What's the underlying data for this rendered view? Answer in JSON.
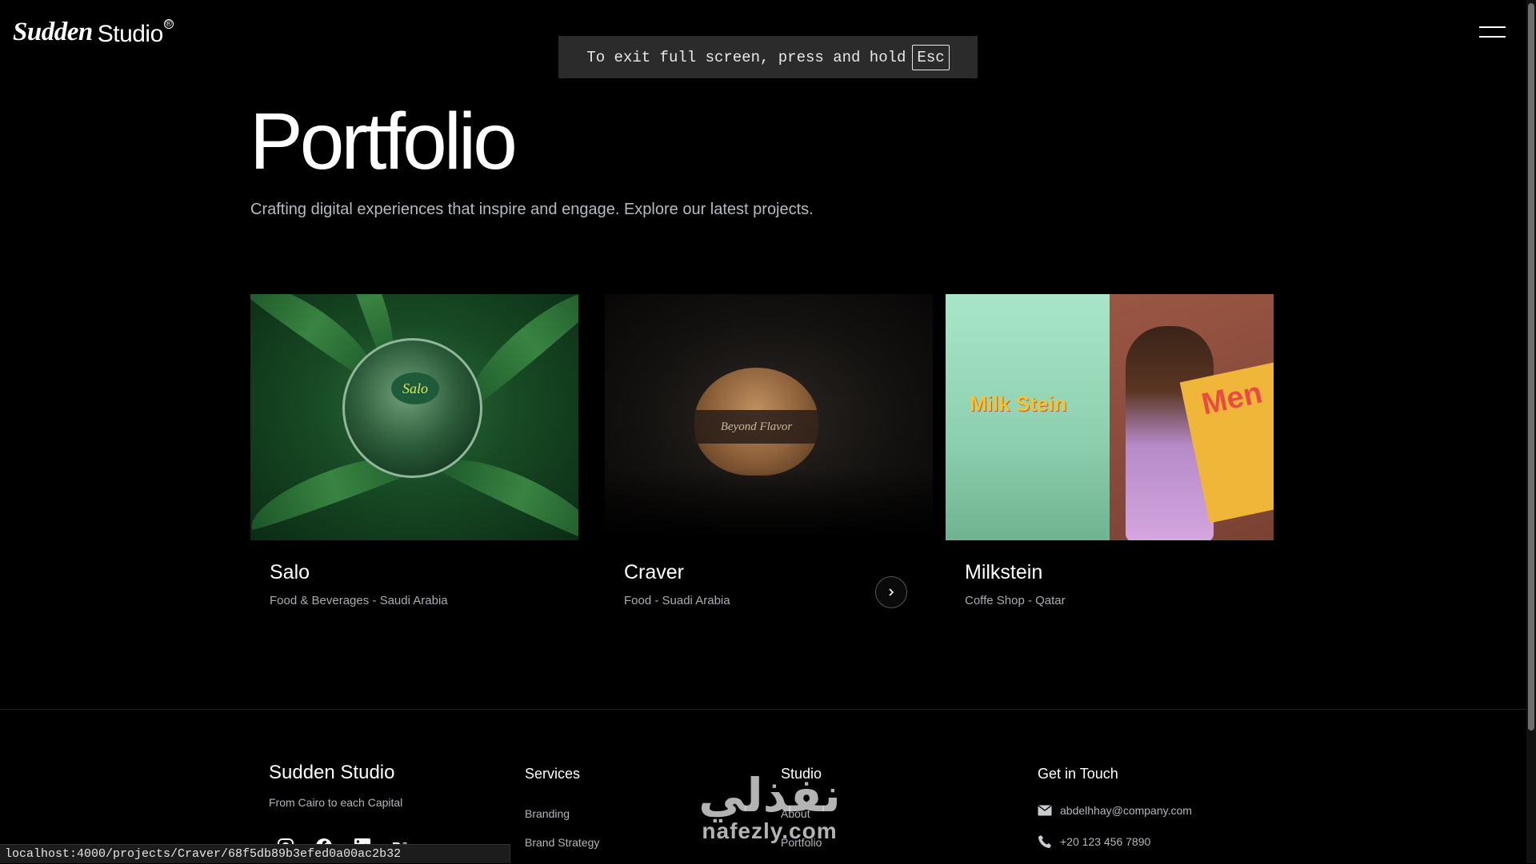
{
  "header": {
    "logo_bold": "Sudden",
    "logo_light": "Studio",
    "logo_reg": "®",
    "menu_icon": "hamburger-icon"
  },
  "fullscreen_toast": {
    "text": "To exit full screen, press and hold",
    "key": "Esc"
  },
  "hero": {
    "title": "Portfolio",
    "intro": "Crafting digital experiences that inspire and engage. Explore our latest projects."
  },
  "projects": [
    {
      "name": "Salo",
      "meta": "Food & Beverages - Saudi Arabia",
      "image_text": "Salo"
    },
    {
      "name": "Craver",
      "meta": "Food - Suadi Arabia",
      "image_text": "Beyond Flavor",
      "action_icon": "chevron-right-icon"
    },
    {
      "name": "Milkstein",
      "meta": "Coffe Shop - Qatar",
      "image_text_left": "Milk Stein",
      "image_text_right": "Men"
    }
  ],
  "footer": {
    "brand": "Sudden Studio",
    "tagline": "From Cairo to each Capital",
    "services_title": "Services",
    "services": [
      "Branding",
      "Brand Strategy"
    ],
    "studio_title": "Studio",
    "studio_links": [
      "About",
      "Portfolio"
    ],
    "contact_title": "Get in Touch",
    "email": "abdelhhay@company.com",
    "phone": "+20 123 456 7890",
    "socials": [
      "instagram-icon",
      "facebook-icon",
      "linkedin-icon",
      "behance-icon"
    ]
  },
  "status_bar": {
    "url": "localhost:4000/projects/Craver/68f5db89b3efed0a00ac2b32"
  },
  "watermark": {
    "arabic": "نفذلي",
    "latin": "nafezly.com"
  }
}
